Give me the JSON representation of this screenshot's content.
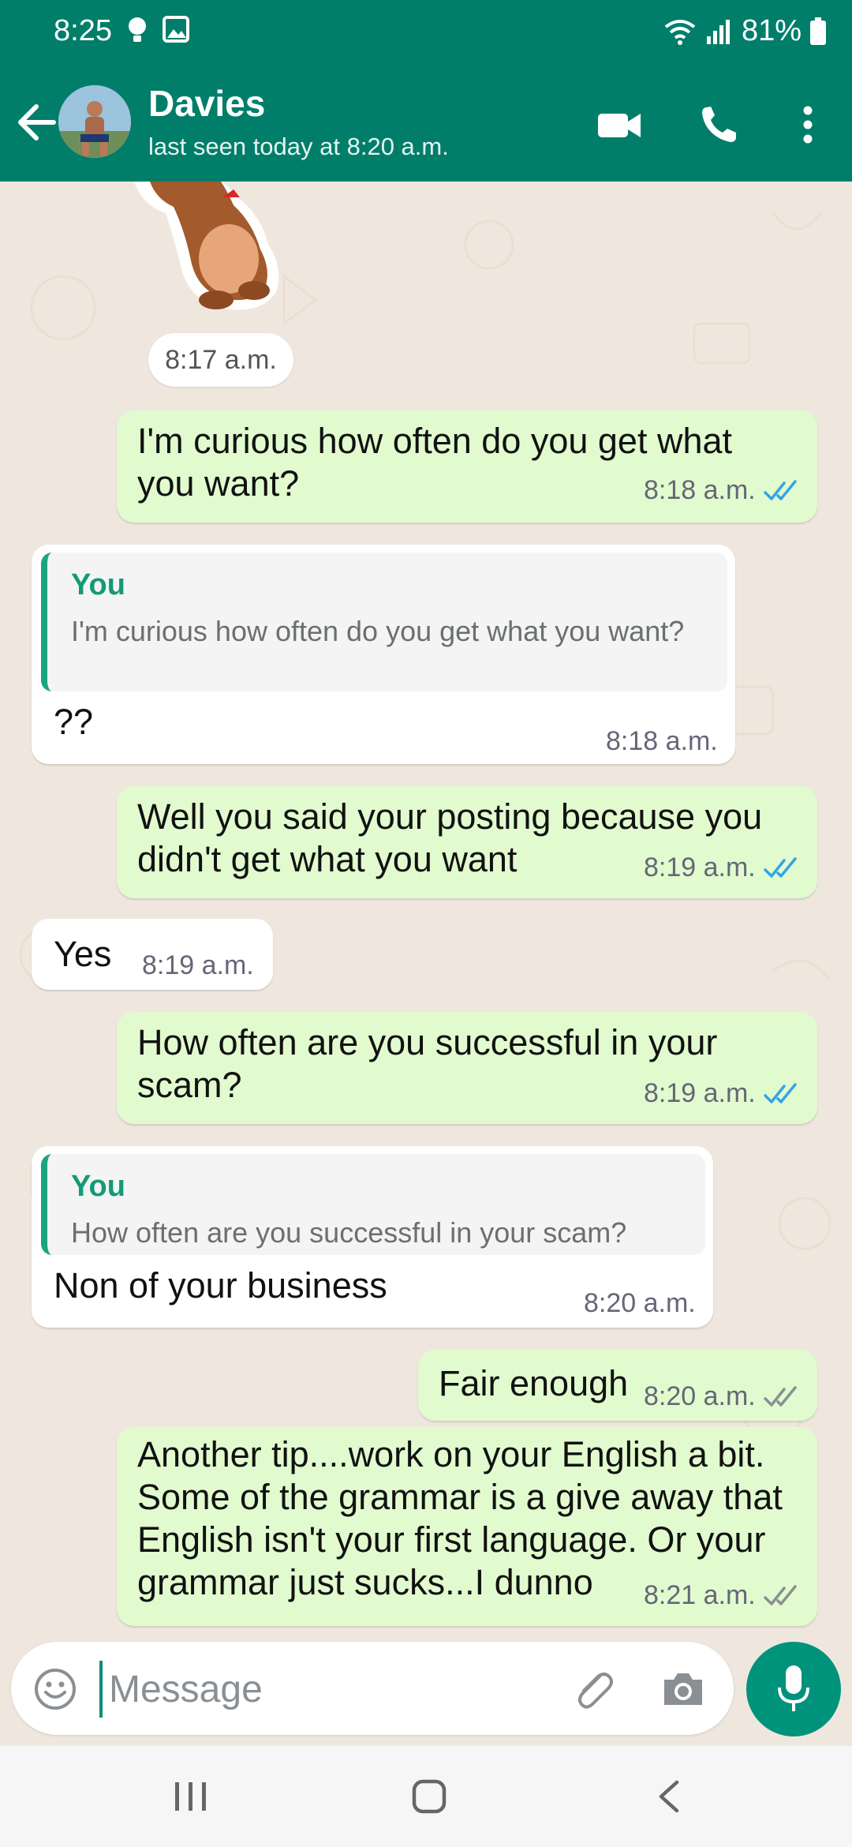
{
  "status_bar": {
    "time": "8:25",
    "battery": "81%"
  },
  "header": {
    "contact_name": "Davies",
    "last_seen": "last seen today at 8:20 a.m."
  },
  "sticker_time": "8:17 a.m.",
  "messages": [
    {
      "direction": "out",
      "text": "I'm curious how often do you get what you want?",
      "time": "8:18 a.m.",
      "status": "read"
    },
    {
      "direction": "in",
      "quote_author": "You",
      "quote_text": "I'm curious how often do you get what you want?",
      "text": "??",
      "time": "8:18 a.m."
    },
    {
      "direction": "out",
      "text": "Well you said your posting because you didn't get what you want",
      "time": "8:19 a.m.",
      "status": "read"
    },
    {
      "direction": "in",
      "text": "Yes",
      "time": "8:19 a.m."
    },
    {
      "direction": "out",
      "text": "How often are you successful in your scam?",
      "time": "8:19 a.m.",
      "status": "read"
    },
    {
      "direction": "in",
      "quote_author": "You",
      "quote_text": "How often are you successful in your scam?",
      "text": "Non of your business",
      "time": "8:20 a.m."
    },
    {
      "direction": "out",
      "text": "Fair enough",
      "time": "8:20 a.m.",
      "status": "delivered"
    },
    {
      "direction": "out",
      "text": "Another tip....work on your English a bit. Some of the grammar is a give away that English isn't your first language. Or your grammar just sucks...I dunno",
      "time": "8:21 a.m.",
      "status": "delivered"
    }
  ],
  "composer": {
    "placeholder": "Message"
  },
  "colors": {
    "header": "#007e6a",
    "outgoing_bubble": "#e1fbcf",
    "incoming_bubble": "#ffffff",
    "read_tick": "#34a4e6",
    "accent": "#00937c"
  }
}
